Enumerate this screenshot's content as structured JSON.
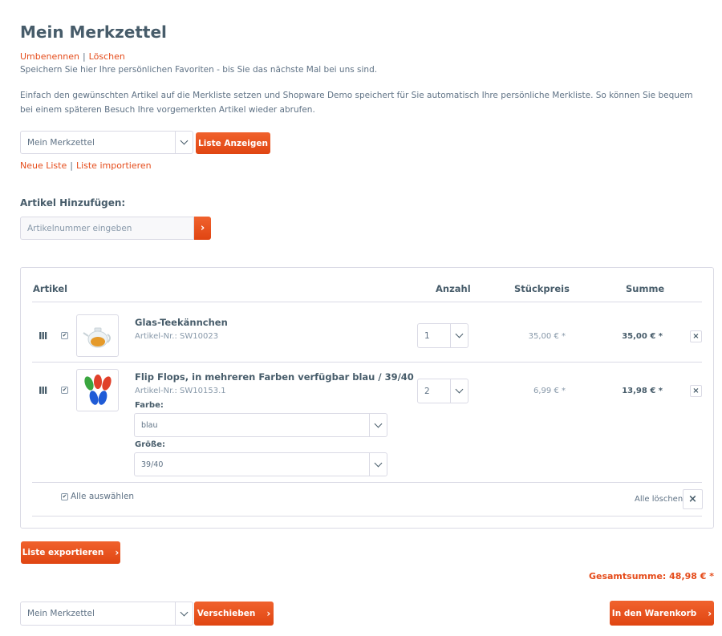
{
  "page": {
    "title": "Mein Merkzettel",
    "rename_label": "Umbenennen",
    "delete_label": "Löschen",
    "subtitle": "Speichern Sie hier Ihre persönlichen Favoriten - bis Sie das nächste Mal bei uns sind.",
    "description": "Einfach den gewünschten Artikel auf die Merkliste setzen und Shopware Demo speichert für Sie automatisch Ihre persönliche Merkliste. So können Sie bequem bei einem späteren Besuch Ihre vorgemerkten Artikel wieder abrufen."
  },
  "list_select": {
    "value": "Mein Merkzettel",
    "show_button": "Liste Anzeigen",
    "new_list_label": "Neue Liste",
    "import_list_label": "Liste importieren"
  },
  "add_article": {
    "heading": "Artikel Hinzufügen:",
    "placeholder": "Artikelnummer eingeben",
    "submit_glyph": "›"
  },
  "table": {
    "headers": {
      "article": "Artikel",
      "quantity": "Anzahl",
      "unit_price": "Stückpreis",
      "sum": "Summe"
    },
    "rows": [
      {
        "name": "Glas-Teekännchen",
        "number": "Artikel-Nr.: SW10023",
        "quantity": "1",
        "unit_price": "35,00 € *",
        "sum": "35,00 € *",
        "image": "teapot-image"
      },
      {
        "name": "Flip Flops, in mehreren Farben verfügbar blau / 39/40",
        "number": "Artikel-Nr.: SW10153.1",
        "quantity": "2",
        "unit_price": "6,99 € *",
        "sum": "13,98 € *",
        "image": "flip-flops-image",
        "color_label": "Farbe:",
        "color_value": "blau",
        "size_label": "Größe:",
        "size_value": "39/40"
      }
    ],
    "select_all_label": "Alle auswählen",
    "delete_all_label": "Alle löschen",
    "remove_glyph": "×"
  },
  "footer": {
    "export_button": "Liste exportieren",
    "total": "Gesamtsumme: 48,98 € *",
    "move_select_value": "Mein Merkzettel",
    "move_button": "Verschieben",
    "cart_button": "In den Warenkorb",
    "arrow_glyph": "›"
  },
  "colors": {
    "accent": "#e54c1b",
    "text": "#5f7285",
    "heading": "#475c6a",
    "border": "#dadae5"
  }
}
